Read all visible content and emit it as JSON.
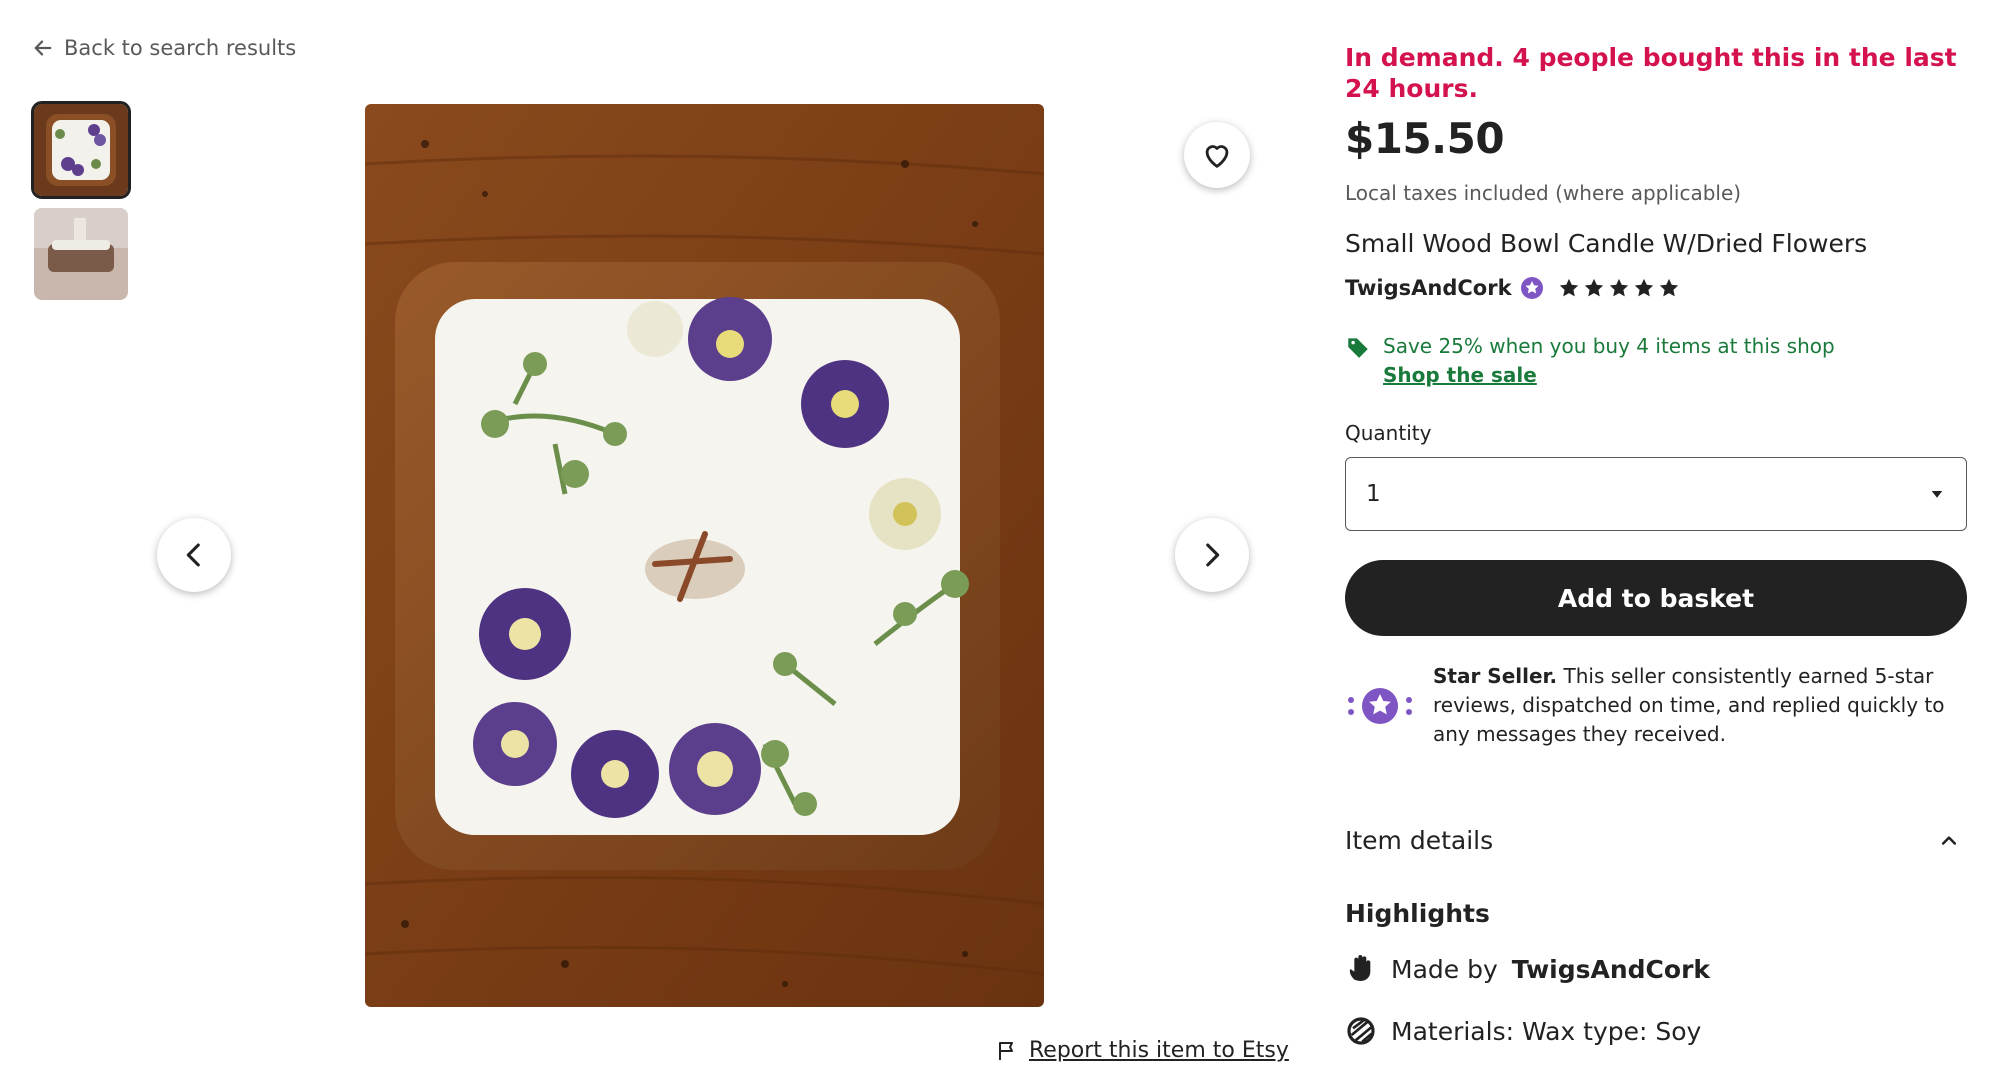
{
  "nav": {
    "back_label": "Back to search results"
  },
  "gallery": {
    "thumbnails": [
      {
        "name": "candle top view",
        "selected": true
      },
      {
        "name": "candle side view",
        "selected": false
      }
    ],
    "report_label": "Report this item to Etsy"
  },
  "listing": {
    "demand_text": "In demand. 4 people bought this in the last 24 hours.",
    "price": "$15.50",
    "taxes_note": "Local taxes included (where applicable)",
    "title": "Small Wood Bowl Candle W/Dried Flowers",
    "shop_name": "TwigsAndCork",
    "rating": 5,
    "sale_text": "Save 25% when you buy 4 items at this shop",
    "sale_link": "Shop the sale",
    "quantity_label": "Quantity",
    "quantity_value": "1",
    "add_button": "Add to basket",
    "star_seller_title": "Star Seller.",
    "star_seller_text": "This seller consistently earned 5-star reviews, dispatched on time, and replied quickly to any messages they received.",
    "item_details_label": "Item details",
    "highlights_label": "Highlights",
    "made_by_prefix": "Made by",
    "made_by_shop": "TwigsAndCork",
    "materials": "Materials: Wax type: Soy"
  },
  "colors": {
    "demand": "#d4124d",
    "sale_green": "#1a7a3c",
    "button_dark": "#222222",
    "star_seller_purple": "#7f55c3"
  },
  "icons": [
    "arrow-left-icon",
    "heart-icon",
    "chevron-left-icon",
    "chevron-right-icon",
    "flag-icon",
    "star-seller-badge-icon",
    "star-icon",
    "tag-icon",
    "caret-down-icon",
    "chevron-up-icon",
    "hand-wave-icon",
    "materials-icon"
  ]
}
